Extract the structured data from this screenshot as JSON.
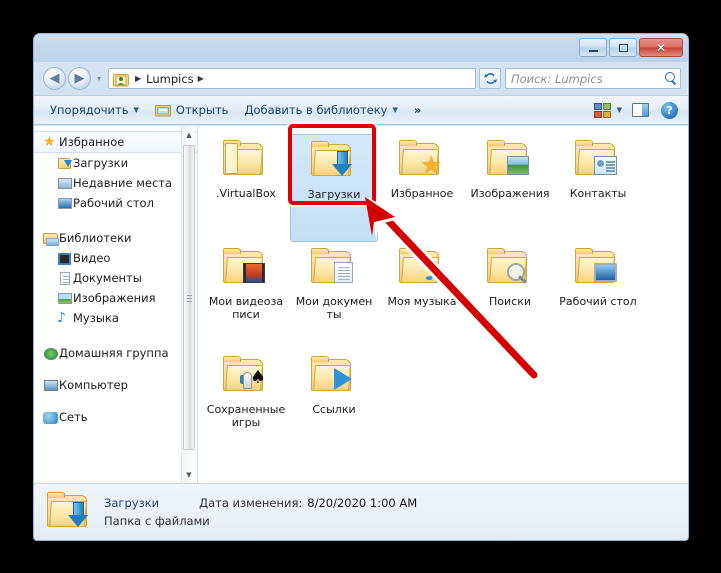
{
  "window": {
    "title": "",
    "controls": {
      "minimize_label": "—",
      "maximize_label": "▫",
      "close_label": "✕"
    }
  },
  "navbar": {
    "back_glyph": "◀",
    "forward_glyph": "▶",
    "history_dropdown_glyph": "▾",
    "breadcrumb": [
      {
        "label": "Lumpics"
      }
    ],
    "breadcrumb_separator": "▶",
    "refresh_glyph": "↻",
    "search": {
      "placeholder": "Поиск: Lumpics",
      "value": ""
    }
  },
  "toolbar": {
    "organize_label": "Упорядочить",
    "open_label": "Открыть",
    "add_to_library_label": "Добавить в библиотеку",
    "overflow_label": "»",
    "caret": "▼",
    "views_caret": "▼",
    "help_label": "?"
  },
  "sidebar": {
    "groups": [
      {
        "header": {
          "label": "Избранное",
          "icon": "star-icon",
          "selected": true
        },
        "items": [
          {
            "label": "Загрузки",
            "icon": "downloads-folder-icon"
          },
          {
            "label": "Недавние места",
            "icon": "recent-places-icon"
          },
          {
            "label": "Рабочий стол",
            "icon": "desktop-icon"
          }
        ]
      },
      {
        "header": {
          "label": "Библиотеки",
          "icon": "libraries-icon",
          "selected": false
        },
        "items": [
          {
            "label": "Видео",
            "icon": "video-icon"
          },
          {
            "label": "Документы",
            "icon": "documents-icon"
          },
          {
            "label": "Изображения",
            "icon": "pictures-icon"
          },
          {
            "label": "Музыка",
            "icon": "music-icon"
          }
        ]
      },
      {
        "header": {
          "label": "Домашняя группа",
          "icon": "homegroup-icon",
          "selected": false
        },
        "items": []
      },
      {
        "header": {
          "label": "Компьютер",
          "icon": "computer-icon",
          "selected": false
        },
        "items": []
      },
      {
        "header": {
          "label": "Сеть",
          "icon": "network-icon",
          "selected": false
        },
        "items": []
      }
    ],
    "scrollbar": {
      "up_glyph": "▲",
      "down_glyph": "▼"
    }
  },
  "files": [
    {
      "name": ".VirtualBox",
      "icon": "folder-icon",
      "overlay": "none",
      "selected": false
    },
    {
      "name": "Загрузки",
      "icon": "folder-icon",
      "overlay": "down-arrow",
      "selected": true
    },
    {
      "name": "Избранное",
      "icon": "folder-icon",
      "overlay": "star",
      "selected": false
    },
    {
      "name": "Изображения",
      "icon": "folder-icon",
      "overlay": "picture",
      "selected": false
    },
    {
      "name": "Контакты",
      "icon": "folder-icon",
      "overlay": "contact-card",
      "selected": false
    },
    {
      "name": "Мои видеозаписи",
      "icon": "folder-icon",
      "overlay": "film",
      "selected": false
    },
    {
      "name": "Мои документы",
      "icon": "folder-icon",
      "overlay": "document",
      "selected": false
    },
    {
      "name": "Моя музыка",
      "icon": "folder-icon",
      "overlay": "music-note",
      "selected": false
    },
    {
      "name": "Поиски",
      "icon": "folder-icon",
      "overlay": "magnifier",
      "selected": false
    },
    {
      "name": "Рабочий стол",
      "icon": "folder-icon",
      "overlay": "monitor",
      "selected": false
    },
    {
      "name": "Сохраненные игры",
      "icon": "folder-icon",
      "overlay": "game",
      "selected": false
    },
    {
      "name": "Ссылки",
      "icon": "folder-icon",
      "overlay": "link-arrow",
      "selected": false
    }
  ],
  "statusbar": {
    "item_name": "Загрузки",
    "item_type": "Папка с файлами",
    "date_label": "Дата изменения:",
    "date_value": "8/20/2020 1:00 AM"
  },
  "annotation": {
    "highlight_color": "#e00000",
    "target": "Загрузки"
  }
}
